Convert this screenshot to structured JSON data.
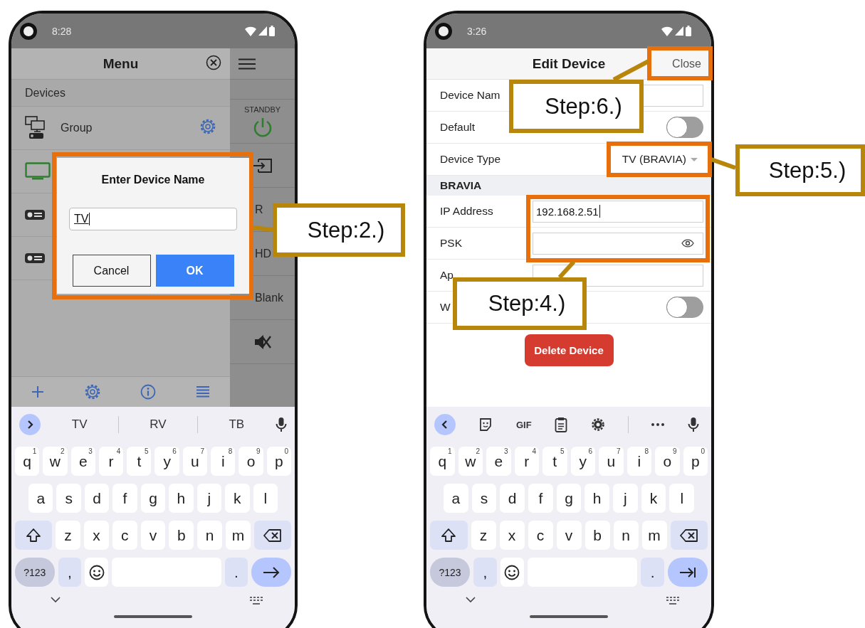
{
  "left_phone": {
    "status_bar": {
      "time": "8:28"
    },
    "menu": {
      "title": "Menu",
      "section": "Devices",
      "devices": [
        {
          "kind": "group",
          "name": "Group"
        },
        {
          "kind": "tv"
        },
        {
          "kind": "projector"
        },
        {
          "kind": "projector"
        }
      ]
    },
    "side_panel": [
      {
        "kind": "standby",
        "label": "STANDBY"
      },
      {
        "kind": "input"
      },
      {
        "kind": "text",
        "label": "R"
      },
      {
        "kind": "text",
        "label": "HD"
      },
      {
        "kind": "text",
        "label": "Blank"
      },
      {
        "kind": "mute"
      }
    ],
    "dialog": {
      "title": "Enter Device Name",
      "value": "TV",
      "buttons": [
        {
          "kind": "secondary",
          "label": "Cancel"
        },
        {
          "kind": "primary",
          "label": "OK"
        }
      ]
    },
    "keyboard": {
      "suggestions": [
        "TV",
        "RV",
        "TB"
      ],
      "rows": [
        {
          "keys": [
            {
              "kind": "char",
              "label": "q",
              "hint": "1"
            },
            {
              "kind": "char",
              "label": "w",
              "hint": "2"
            },
            {
              "kind": "char",
              "label": "e",
              "hint": "3"
            },
            {
              "kind": "char",
              "label": "r",
              "hint": "4"
            },
            {
              "kind": "char",
              "label": "t",
              "hint": "5"
            },
            {
              "kind": "char",
              "label": "y",
              "hint": "6"
            },
            {
              "kind": "char",
              "label": "u",
              "hint": "7"
            },
            {
              "kind": "char",
              "label": "i",
              "hint": "8"
            },
            {
              "kind": "char",
              "label": "o",
              "hint": "9"
            },
            {
              "kind": "char",
              "label": "p",
              "hint": "0"
            }
          ]
        },
        {
          "keys": [
            {
              "kind": "char",
              "label": "a"
            },
            {
              "kind": "char",
              "label": "s"
            },
            {
              "kind": "char",
              "label": "d"
            },
            {
              "kind": "char",
              "label": "f"
            },
            {
              "kind": "char",
              "label": "g"
            },
            {
              "kind": "char",
              "label": "h"
            },
            {
              "kind": "char",
              "label": "j"
            },
            {
              "kind": "char",
              "label": "k"
            },
            {
              "kind": "char",
              "label": "l"
            }
          ]
        },
        {
          "keys": [
            {
              "kind": "shift"
            },
            {
              "kind": "char",
              "label": "z"
            },
            {
              "kind": "char",
              "label": "x"
            },
            {
              "kind": "char",
              "label": "c"
            },
            {
              "kind": "char",
              "label": "v"
            },
            {
              "kind": "char",
              "label": "b"
            },
            {
              "kind": "char",
              "label": "n"
            },
            {
              "kind": "char",
              "label": "m"
            },
            {
              "kind": "backspace"
            }
          ]
        },
        {
          "keys": [
            {
              "kind": "symbols",
              "label": "?123"
            },
            {
              "kind": "punct",
              "label": ","
            },
            {
              "kind": "emoji"
            },
            {
              "kind": "space"
            },
            {
              "kind": "punct",
              "label": "."
            },
            {
              "kind": "enter"
            }
          ]
        }
      ]
    }
  },
  "right_phone": {
    "status_bar": {
      "time": "3:26"
    },
    "header": {
      "title": "Edit Device",
      "close": "Close"
    },
    "fields": [
      {
        "kind": "text",
        "label": "Device Nam"
      },
      {
        "kind": "toggle",
        "label": "Default",
        "on": false
      },
      {
        "kind": "select",
        "label": "Device Type",
        "value": "TV (BRAVIA)"
      },
      {
        "kind": "section",
        "label": "BRAVIA"
      },
      {
        "kind": "text",
        "label": "IP Address",
        "value": "192.168.2.51"
      },
      {
        "kind": "password",
        "label": "PSK"
      },
      {
        "kind": "text",
        "label": "Ap"
      },
      {
        "kind": "toggle",
        "label": "W",
        "on": false
      }
    ],
    "delete_button": "Delete Device",
    "keyboard": {
      "toolbar": [
        {
          "kind": "collapse"
        },
        {
          "kind": "sticker"
        },
        {
          "kind": "gif",
          "label": "GIF"
        },
        {
          "kind": "clipboard"
        },
        {
          "kind": "settings"
        },
        {
          "kind": "divider"
        },
        {
          "kind": "more"
        },
        {
          "kind": "mic"
        }
      ],
      "rows": [
        {
          "keys": [
            {
              "kind": "char",
              "label": "q",
              "hint": "1"
            },
            {
              "kind": "char",
              "label": "w",
              "hint": "2"
            },
            {
              "kind": "char",
              "label": "e",
              "hint": "3"
            },
            {
              "kind": "char",
              "label": "r",
              "hint": "4"
            },
            {
              "kind": "char",
              "label": "t",
              "hint": "5"
            },
            {
              "kind": "char",
              "label": "y",
              "hint": "6"
            },
            {
              "kind": "char",
              "label": "u",
              "hint": "7"
            },
            {
              "kind": "char",
              "label": "i",
              "hint": "8"
            },
            {
              "kind": "char",
              "label": "o",
              "hint": "9"
            },
            {
              "kind": "char",
              "label": "p",
              "hint": "0"
            }
          ]
        },
        {
          "keys": [
            {
              "kind": "char",
              "label": "a"
            },
            {
              "kind": "char",
              "label": "s"
            },
            {
              "kind": "char",
              "label": "d"
            },
            {
              "kind": "char",
              "label": "f"
            },
            {
              "kind": "char",
              "label": "g"
            },
            {
              "kind": "char",
              "label": "h"
            },
            {
              "kind": "char",
              "label": "j"
            },
            {
              "kind": "char",
              "label": "k"
            },
            {
              "kind": "char",
              "label": "l"
            }
          ]
        },
        {
          "keys": [
            {
              "kind": "shift"
            },
            {
              "kind": "char",
              "label": "z"
            },
            {
              "kind": "char",
              "label": "x"
            },
            {
              "kind": "char",
              "label": "c"
            },
            {
              "kind": "char",
              "label": "v"
            },
            {
              "kind": "char",
              "label": "b"
            },
            {
              "kind": "char",
              "label": "n"
            },
            {
              "kind": "char",
              "label": "m"
            },
            {
              "kind": "backspace"
            }
          ]
        },
        {
          "keys": [
            {
              "kind": "symbols",
              "label": "?123"
            },
            {
              "kind": "punct",
              "label": ","
            },
            {
              "kind": "emoji"
            },
            {
              "kind": "space"
            },
            {
              "kind": "punct",
              "label": "."
            },
            {
              "kind": "tab"
            }
          ]
        }
      ]
    }
  },
  "callouts": [
    {
      "text": "Step:2.)"
    },
    {
      "text": "Step:6.)"
    },
    {
      "text": "Step:5.)"
    },
    {
      "text": "Step:4.)"
    }
  ]
}
